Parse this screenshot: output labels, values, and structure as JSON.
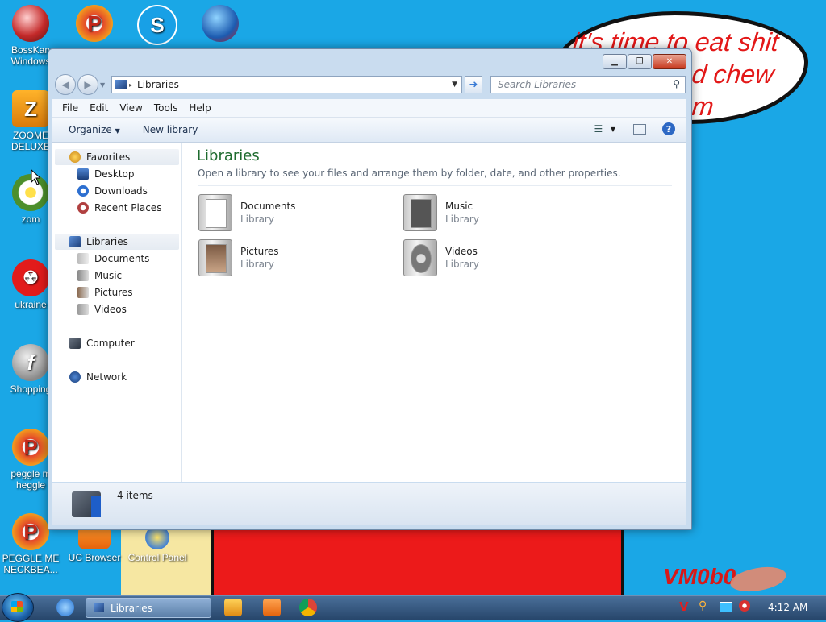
{
  "wallpaper": {
    "speech_line1": "it's time to eat shit",
    "speech_line2": "d chew",
    "speech_line3": "m",
    "signature": "VM0b0"
  },
  "desktop_icons": [
    {
      "label": "BossKan\nWindows",
      "icon": "game-icon"
    },
    {
      "label": "ZOOME\nDELUXE",
      "icon": "zoome-icon"
    },
    {
      "label": "zom",
      "icon": "flower-icon"
    },
    {
      "label": "ukraine",
      "icon": "radiation-icon"
    },
    {
      "label": "Shopping",
      "icon": "flash-icon"
    },
    {
      "label": "peggle m\nheggle",
      "icon": "peggle-icon"
    },
    {
      "label": "PEGGLE ME\nNECKBEA...",
      "icon": "peggle-icon"
    },
    {
      "label": "UC Browser",
      "icon": "uc-browser-icon"
    },
    {
      "label": "Control Panel",
      "icon": "control-panel-icon"
    }
  ],
  "window": {
    "address": "Libraries",
    "search_placeholder": "Search Libraries",
    "menu": [
      "File",
      "Edit",
      "View",
      "Tools",
      "Help"
    ],
    "toolbar": {
      "organize": "Organize",
      "new_library": "New library"
    },
    "nav": {
      "favorites": "Favorites",
      "desktop": "Desktop",
      "downloads": "Downloads",
      "recent": "Recent Places",
      "libraries": "Libraries",
      "documents": "Documents",
      "music": "Music",
      "pictures": "Pictures",
      "videos": "Videos",
      "computer": "Computer",
      "network": "Network"
    },
    "content": {
      "title": "Libraries",
      "description": "Open a library to see your files and arrange them by folder, date, and other properties.",
      "libraries": [
        {
          "name": "Documents",
          "type": "Library"
        },
        {
          "name": "Music",
          "type": "Library"
        },
        {
          "name": "Pictures",
          "type": "Library"
        },
        {
          "name": "Videos",
          "type": "Library"
        }
      ]
    },
    "details": "4 items"
  },
  "taskbar": {
    "task_label": "Libraries",
    "clock": "4:12 AM"
  }
}
